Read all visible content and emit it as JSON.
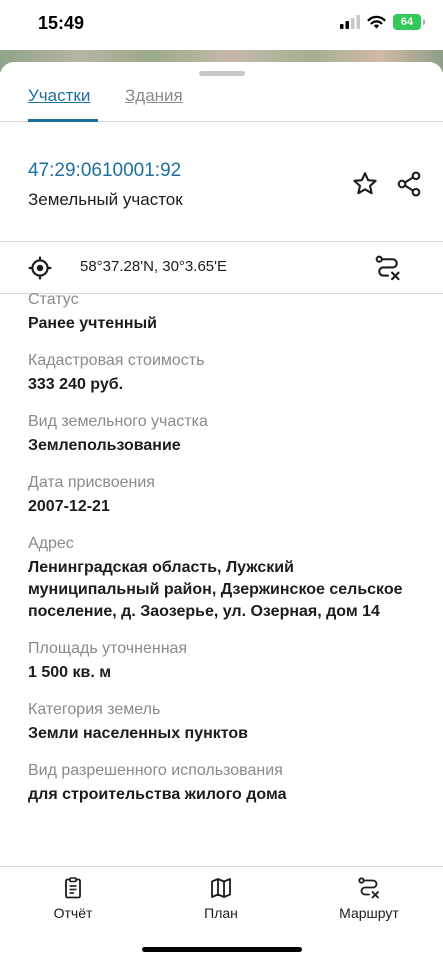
{
  "status_bar": {
    "time": "15:49",
    "battery": "64"
  },
  "tabs": [
    {
      "label": "Участки",
      "active": true
    },
    {
      "label": "Здания",
      "active": false
    }
  ],
  "parcel": {
    "cadastral_number": "47:29:0610001:92",
    "type": "Земельный участок",
    "actions": [
      "star-icon",
      "share-icon"
    ]
  },
  "coordinates": {
    "icon": "location-target-icon",
    "text": "58°37.28'N, 30°3.65'E",
    "route_icon": "route-icon"
  },
  "fields": [
    {
      "label": "Статус",
      "value": "Ранее учтенный"
    },
    {
      "label": "Кадастровая стоимость",
      "value": "333 240 руб."
    },
    {
      "label": "Вид земельного участка",
      "value": "Землепользование"
    },
    {
      "label": "Дата присвоения",
      "value": "2007-12-21"
    },
    {
      "label": "Адрес",
      "value": "Ленинградская область, Лужский муниципальный район, Дзержинское сельское поселение, д. Заозерье, ул. Озерная, дом 14"
    },
    {
      "label": "Площадь уточненная",
      "value": "1 500 кв. м"
    },
    {
      "label": "Категория земель",
      "value": "Земли населенных пунктов"
    },
    {
      "label": "Вид разрешенного использования",
      "value": "для строительства жилого дома"
    }
  ],
  "bottom_nav": [
    {
      "label": "Отчёт",
      "icon": "report-icon"
    },
    {
      "label": "План",
      "icon": "map-icon"
    },
    {
      "label": "Маршрут",
      "icon": "route-icon"
    }
  ],
  "colors": {
    "accent": "#1f6f9c",
    "muted": "#8a8a8e",
    "battery": "#34c759"
  }
}
